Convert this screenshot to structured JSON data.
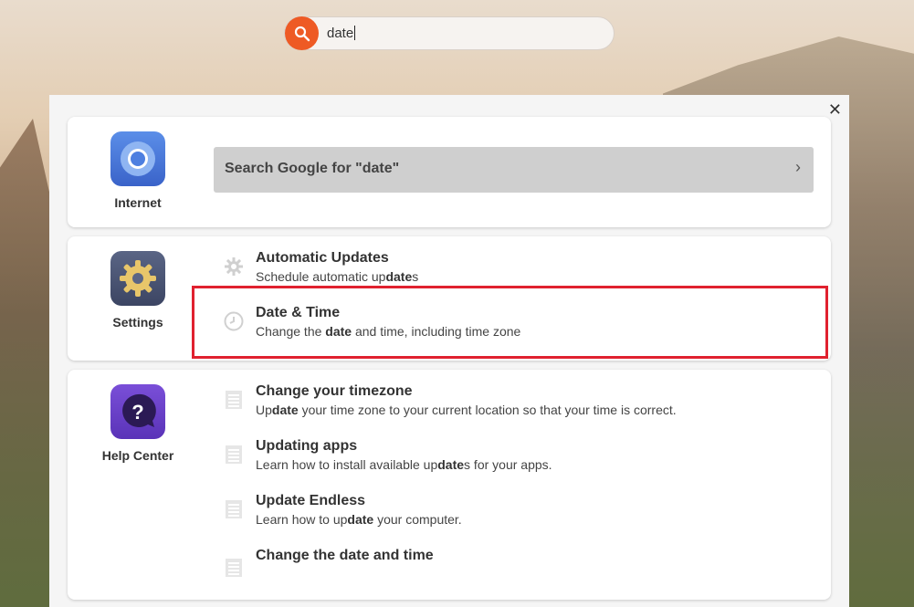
{
  "search": {
    "query": "date"
  },
  "close_symbol": "✕",
  "internet_card": {
    "app_label": "Internet",
    "google_label": "Search Google for \"date\"",
    "chevron": "›"
  },
  "settings_card": {
    "app_label": "Settings",
    "results": [
      {
        "title": "Automatic Updates",
        "sub_pre": "Schedule automatic up",
        "sub_bold": "date",
        "sub_post": "s"
      },
      {
        "title": "Date & Time",
        "sub_pre": "Change the ",
        "sub_bold": "date",
        "sub_post": " and time, including time zone"
      }
    ]
  },
  "help_card": {
    "app_label": "Help Center",
    "results": [
      {
        "title": "Change your timezone",
        "sub_pre": "Up",
        "sub_bold": "date",
        "sub_post": " your time zone to your current location so that your time is correct."
      },
      {
        "title": "Updating apps",
        "sub_pre": "Learn how to install available up",
        "sub_bold": "date",
        "sub_post": "s for your apps."
      },
      {
        "title": "Update Endless",
        "sub_pre": "Learn how to up",
        "sub_bold": "date",
        "sub_post": " your computer."
      },
      {
        "title": "Change the date and time"
      }
    ]
  },
  "colors": {
    "accent": "#ee5a24",
    "highlight": "#e0212f"
  }
}
